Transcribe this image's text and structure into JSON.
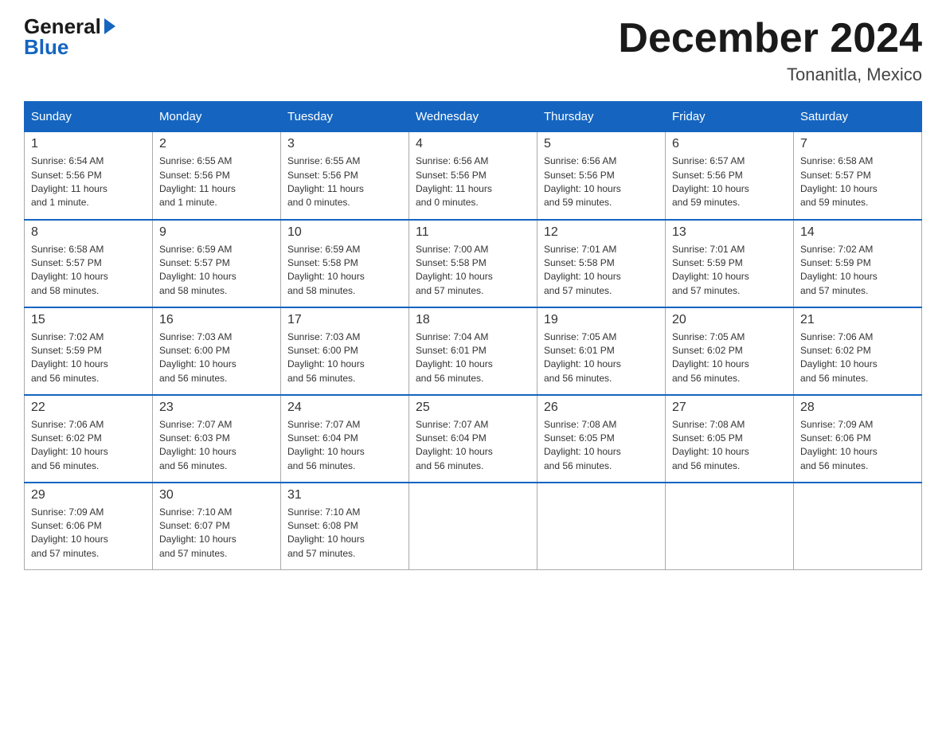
{
  "header": {
    "logo_general": "General",
    "logo_blue": "Blue",
    "month_title": "December 2024",
    "location": "Tonanitla, Mexico"
  },
  "weekdays": [
    "Sunday",
    "Monday",
    "Tuesday",
    "Wednesday",
    "Thursday",
    "Friday",
    "Saturday"
  ],
  "weeks": [
    [
      {
        "day": "1",
        "sunrise": "6:54 AM",
        "sunset": "5:56 PM",
        "daylight": "11 hours and 1 minute."
      },
      {
        "day": "2",
        "sunrise": "6:55 AM",
        "sunset": "5:56 PM",
        "daylight": "11 hours and 1 minute."
      },
      {
        "day": "3",
        "sunrise": "6:55 AM",
        "sunset": "5:56 PM",
        "daylight": "11 hours and 0 minutes."
      },
      {
        "day": "4",
        "sunrise": "6:56 AM",
        "sunset": "5:56 PM",
        "daylight": "11 hours and 0 minutes."
      },
      {
        "day": "5",
        "sunrise": "6:56 AM",
        "sunset": "5:56 PM",
        "daylight": "10 hours and 59 minutes."
      },
      {
        "day": "6",
        "sunrise": "6:57 AM",
        "sunset": "5:56 PM",
        "daylight": "10 hours and 59 minutes."
      },
      {
        "day": "7",
        "sunrise": "6:58 AM",
        "sunset": "5:57 PM",
        "daylight": "10 hours and 59 minutes."
      }
    ],
    [
      {
        "day": "8",
        "sunrise": "6:58 AM",
        "sunset": "5:57 PM",
        "daylight": "10 hours and 58 minutes."
      },
      {
        "day": "9",
        "sunrise": "6:59 AM",
        "sunset": "5:57 PM",
        "daylight": "10 hours and 58 minutes."
      },
      {
        "day": "10",
        "sunrise": "6:59 AM",
        "sunset": "5:58 PM",
        "daylight": "10 hours and 58 minutes."
      },
      {
        "day": "11",
        "sunrise": "7:00 AM",
        "sunset": "5:58 PM",
        "daylight": "10 hours and 57 minutes."
      },
      {
        "day": "12",
        "sunrise": "7:01 AM",
        "sunset": "5:58 PM",
        "daylight": "10 hours and 57 minutes."
      },
      {
        "day": "13",
        "sunrise": "7:01 AM",
        "sunset": "5:59 PM",
        "daylight": "10 hours and 57 minutes."
      },
      {
        "day": "14",
        "sunrise": "7:02 AM",
        "sunset": "5:59 PM",
        "daylight": "10 hours and 57 minutes."
      }
    ],
    [
      {
        "day": "15",
        "sunrise": "7:02 AM",
        "sunset": "5:59 PM",
        "daylight": "10 hours and 56 minutes."
      },
      {
        "day": "16",
        "sunrise": "7:03 AM",
        "sunset": "6:00 PM",
        "daylight": "10 hours and 56 minutes."
      },
      {
        "day": "17",
        "sunrise": "7:03 AM",
        "sunset": "6:00 PM",
        "daylight": "10 hours and 56 minutes."
      },
      {
        "day": "18",
        "sunrise": "7:04 AM",
        "sunset": "6:01 PM",
        "daylight": "10 hours and 56 minutes."
      },
      {
        "day": "19",
        "sunrise": "7:05 AM",
        "sunset": "6:01 PM",
        "daylight": "10 hours and 56 minutes."
      },
      {
        "day": "20",
        "sunrise": "7:05 AM",
        "sunset": "6:02 PM",
        "daylight": "10 hours and 56 minutes."
      },
      {
        "day": "21",
        "sunrise": "7:06 AM",
        "sunset": "6:02 PM",
        "daylight": "10 hours and 56 minutes."
      }
    ],
    [
      {
        "day": "22",
        "sunrise": "7:06 AM",
        "sunset": "6:02 PM",
        "daylight": "10 hours and 56 minutes."
      },
      {
        "day": "23",
        "sunrise": "7:07 AM",
        "sunset": "6:03 PM",
        "daylight": "10 hours and 56 minutes."
      },
      {
        "day": "24",
        "sunrise": "7:07 AM",
        "sunset": "6:04 PM",
        "daylight": "10 hours and 56 minutes."
      },
      {
        "day": "25",
        "sunrise": "7:07 AM",
        "sunset": "6:04 PM",
        "daylight": "10 hours and 56 minutes."
      },
      {
        "day": "26",
        "sunrise": "7:08 AM",
        "sunset": "6:05 PM",
        "daylight": "10 hours and 56 minutes."
      },
      {
        "day": "27",
        "sunrise": "7:08 AM",
        "sunset": "6:05 PM",
        "daylight": "10 hours and 56 minutes."
      },
      {
        "day": "28",
        "sunrise": "7:09 AM",
        "sunset": "6:06 PM",
        "daylight": "10 hours and 56 minutes."
      }
    ],
    [
      {
        "day": "29",
        "sunrise": "7:09 AM",
        "sunset": "6:06 PM",
        "daylight": "10 hours and 57 minutes."
      },
      {
        "day": "30",
        "sunrise": "7:10 AM",
        "sunset": "6:07 PM",
        "daylight": "10 hours and 57 minutes."
      },
      {
        "day": "31",
        "sunrise": "7:10 AM",
        "sunset": "6:08 PM",
        "daylight": "10 hours and 57 minutes."
      },
      null,
      null,
      null,
      null
    ]
  ],
  "labels": {
    "sunrise": "Sunrise:",
    "sunset": "Sunset:",
    "daylight": "Daylight:"
  }
}
